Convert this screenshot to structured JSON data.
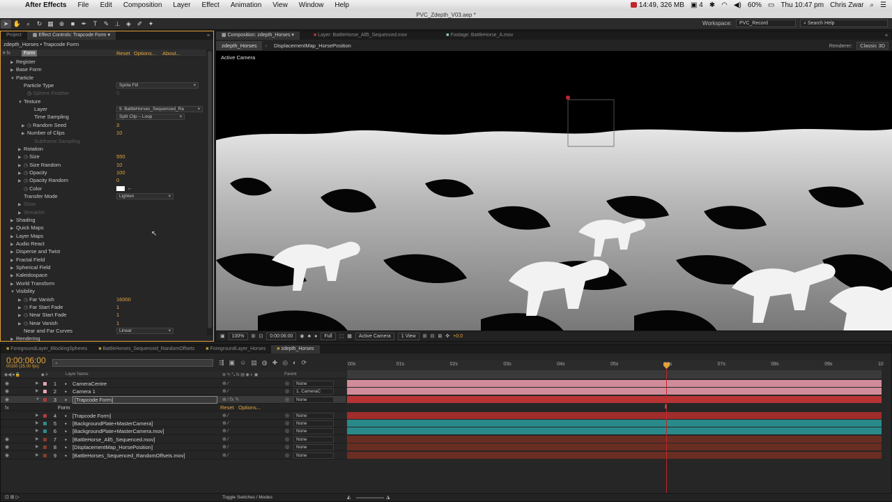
{
  "menubar": {
    "app": "After Effects",
    "items": [
      "File",
      "Edit",
      "Composition",
      "Layer",
      "Effect",
      "Animation",
      "View",
      "Window",
      "Help"
    ],
    "status": "14:49, 326 MB",
    "badge": "4",
    "battery": "60%",
    "clock": "Thu 10:47 pm",
    "user": "Chris Zwar"
  },
  "window_title": "PVC_Zdepth_V03.aep *",
  "workspace": {
    "label": "Workspace:",
    "value": "PVC_Record",
    "search_placeholder": "Search Help"
  },
  "effects_panel": {
    "tabs": [
      "Project",
      "Effect Controls: Trapcode Form"
    ],
    "breadcrumb": "zdepth_Horses • Trapcode Form",
    "effect": {
      "name": "Form",
      "reset": "Reset",
      "options": "Options...",
      "about": "About..."
    },
    "rows": [
      {
        "label": "Register",
        "indent": 0,
        "arrow": "right"
      },
      {
        "label": "Base Form",
        "indent": 0,
        "arrow": "right"
      },
      {
        "label": "Particle",
        "indent": 0,
        "arrow": "down"
      },
      {
        "label": "Particle Type",
        "indent": 1,
        "select": "Sprite Fill",
        "sw": 118
      },
      {
        "label": "Sphere Feather",
        "indent": 2,
        "value": "0",
        "dim": true,
        "stopwatch": true
      },
      {
        "label": "Texture",
        "indent": 1,
        "arrow": "down"
      },
      {
        "label": "Layer",
        "indent": 3,
        "select": "9. BattleHorses_Sequenced_Ra",
        "sw": 124
      },
      {
        "label": "Time Sampling",
        "indent": 3,
        "select": "Split Clip – Loop",
        "sw": 98
      },
      {
        "label": "Random Seed",
        "indent": 2,
        "value": "3",
        "stopwatch": true,
        "arrow": "right"
      },
      {
        "label": "Number of Clips",
        "indent": 2,
        "value": "10",
        "arrow": "right"
      },
      {
        "label": "Subframe Sampling",
        "indent": 3,
        "dim": true
      },
      {
        "label": "Rotation",
        "indent": 1,
        "arrow": "right"
      },
      {
        "label": "Size",
        "indent": 1,
        "value": "550",
        "stopwatch": true,
        "arrow": "right"
      },
      {
        "label": "Size Random",
        "indent": 1,
        "value": "10",
        "stopwatch": true,
        "arrow": "right"
      },
      {
        "label": "Opacity",
        "indent": 1,
        "value": "100",
        "stopwatch": true,
        "arrow": "right"
      },
      {
        "label": "Opacity Random",
        "indent": 1,
        "value": "0",
        "stopwatch": true,
        "arrow": "right"
      },
      {
        "label": "Color",
        "indent": 1,
        "stopwatch": true,
        "color": true
      },
      {
        "label": "Transfer Mode",
        "indent": 1,
        "select": "Lighten",
        "sw": 82
      },
      {
        "label": "Glow",
        "indent": 1,
        "dim": true,
        "arrow": "right"
      },
      {
        "label": "Streaklet",
        "indent": 1,
        "dim": true,
        "arrow": "right"
      },
      {
        "label": "Shading",
        "indent": 0,
        "arrow": "right"
      },
      {
        "label": "Quick Maps",
        "indent": 0,
        "arrow": "right"
      },
      {
        "label": "Layer Maps",
        "indent": 0,
        "arrow": "right"
      },
      {
        "label": "Audio React",
        "indent": 0,
        "arrow": "right"
      },
      {
        "label": "Disperse and Twist",
        "indent": 0,
        "arrow": "right"
      },
      {
        "label": "Fractal Field",
        "indent": 0,
        "arrow": "right"
      },
      {
        "label": "Spherical Field",
        "indent": 0,
        "arrow": "right"
      },
      {
        "label": "Kaleidospace",
        "indent": 0,
        "arrow": "right"
      },
      {
        "label": "World Transform",
        "indent": 0,
        "arrow": "right"
      },
      {
        "label": "Visibility",
        "indent": 0,
        "arrow": "down"
      },
      {
        "label": "Far Vanish",
        "indent": 1,
        "value": "16000",
        "stopwatch": true,
        "arrow": "right"
      },
      {
        "label": "Far Start Fade",
        "indent": 1,
        "value": "1",
        "stopwatch": true,
        "arrow": "right"
      },
      {
        "label": "Near Start Fade",
        "indent": 1,
        "value": "1",
        "stopwatch": true,
        "arrow": "right"
      },
      {
        "label": "Near Vanish",
        "indent": 1,
        "value": "1",
        "stopwatch": true,
        "arrow": "right"
      },
      {
        "label": "Near and Far Curves",
        "indent": 1,
        "select": "Linear",
        "sw": 82
      },
      {
        "label": "Rendering",
        "indent": 0,
        "arrow": "right"
      }
    ]
  },
  "comp_panel": {
    "tabs": [
      "Composition: zdepth_Horses",
      "Layer: BattleHorse_All5_Sequenced.mov",
      "Footage: BattleHorse_A.mov"
    ],
    "subtabs": [
      "zdepth_Horses",
      "DisplacementMap_HorsePosition"
    ],
    "renderer_label": "Renderer:",
    "renderer": "Classic 3D",
    "view_label": "Active Camera",
    "footer": {
      "zoom": "100%",
      "timecode": "0:00:06:00",
      "resolution": "Full",
      "camera": "Active Camera",
      "views": "1 View",
      "exposure": "+0.0"
    }
  },
  "timeline": {
    "tabs": [
      "ForegroundLayer_BlockingSpheres",
      "BattleHorses_Sequenced_RandomOffsets",
      "ForegroundLayer_Horses",
      "zdepth_Horses"
    ],
    "timecode": "0:00:06:00",
    "fps": "00150 (25.00 fps)",
    "header": {
      "layer_name": "Layer Name",
      "parent": "Parent"
    },
    "ruler": [
      "00s",
      "01s",
      "02s",
      "03s",
      "04s",
      "05s",
      "06s",
      "07s",
      "08s",
      "09s",
      "10"
    ],
    "layers": [
      {
        "num": "1",
        "name": "CameraCentre",
        "color": "#e8a6b4",
        "parent": "None",
        "bar": "#d08c9a"
      },
      {
        "num": "2",
        "name": "Camera 1",
        "color": "#e8a6b4",
        "parent": "1. CameraC",
        "bar": "#d08c9a"
      },
      {
        "num": "3",
        "name": "[Trapcode Form]",
        "color": "#b33a3a",
        "parent": "None",
        "bar": "#b83333",
        "selected": true
      },
      {
        "num": "4",
        "name": "[Trapcode Form]",
        "color": "#b33a3a",
        "parent": "None",
        "bar": "#a02c2c"
      },
      {
        "num": "5",
        "name": "[BackgroundPlate+MasterCamera]",
        "color": "#2f8b8b",
        "parent": "None",
        "bar": "#2a8a8a"
      },
      {
        "num": "6",
        "name": "[BackgroundPlate+MasterCamera.mov]",
        "color": "#2f8b8b",
        "parent": "None",
        "bar": "#2a8a8a"
      },
      {
        "num": "7",
        "name": "[BattleHorse_All5_Sequenced.mov]",
        "color": "#8a3a2a",
        "parent": "None",
        "bar": "#6a2d22"
      },
      {
        "num": "8",
        "name": "[DisplacementMap_HorsePosition]",
        "color": "#8a3a2a",
        "parent": "None",
        "bar": "#6a2d22"
      },
      {
        "num": "9",
        "name": "[BattleHorses_Sequenced_RandomOffsets.mov]",
        "color": "#8a3a2a",
        "parent": "None",
        "bar": "#6a2d22"
      }
    ],
    "form_sub": {
      "label": "Form",
      "reset": "Reset",
      "options": "Options..."
    },
    "toggle_label": "Toggle Switches / Modes"
  },
  "colors": {
    "accent": "#e3a23a",
    "value": "#e7a73c",
    "playhead": "#e3a23a"
  }
}
